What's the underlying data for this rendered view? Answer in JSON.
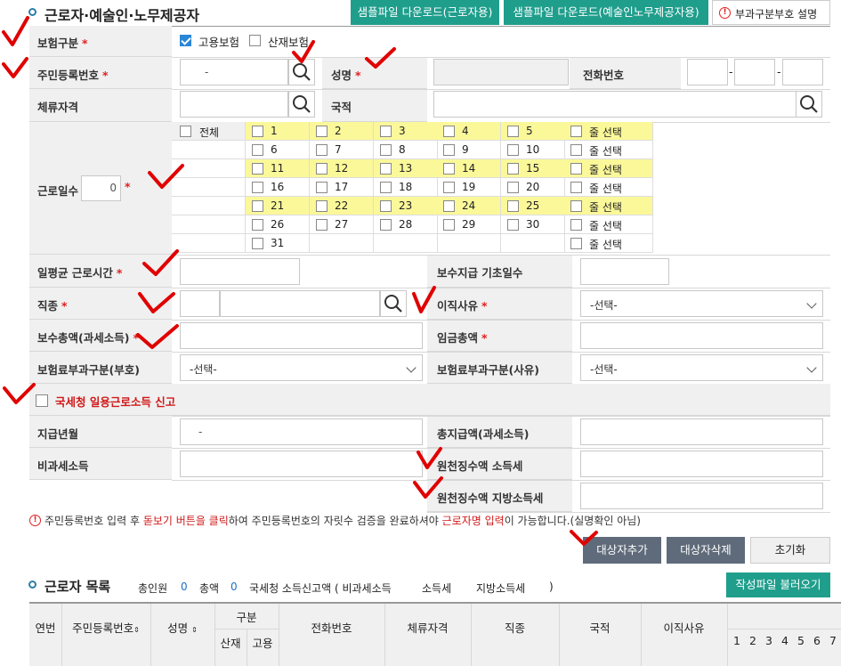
{
  "section_title": "근로자·예술인·노무제공자",
  "header_buttons": {
    "sample_worker": "샘플파일 다운로드(근로자용)",
    "sample_artist": "샘플파일 다운로드(예술인노무제공자용)",
    "code_help": "부과구분부호 설명"
  },
  "form": {
    "insurance_type_label": "보험구분",
    "employment_ins": "고용보험",
    "industrial_ins": "산재보험",
    "rrn_label": "주민등록번호",
    "rrn_dash": "-",
    "name_label": "성명",
    "phone_label": "전화번호",
    "phone_dash1": "-",
    "phone_dash2": "-",
    "stay_label": "체류자격",
    "nation_label": "국적",
    "workdays_label": "근로일수",
    "workdays_value": "0",
    "all_label": "전체",
    "row_select": "줄 선택",
    "days": [
      "1",
      "2",
      "3",
      "4",
      "5",
      "6",
      "7",
      "8",
      "9",
      "10",
      "11",
      "12",
      "13",
      "14",
      "15",
      "16",
      "17",
      "18",
      "19",
      "20",
      "21",
      "22",
      "23",
      "24",
      "25",
      "26",
      "27",
      "28",
      "29",
      "30",
      "31"
    ],
    "avg_hours_label": "일평균 근로시간",
    "pay_base_days_label": "보수지급 기초일수",
    "job_label": "직종",
    "leave_reason_label": "이직사유",
    "leave_reason_value": "-선택-",
    "total_pay_label": "보수총액(과세소득)",
    "wage_total_label": "임금총액",
    "ins_code_label": "보험료부과구분(부호)",
    "ins_code_value": "-선택-",
    "ins_reason_label": "보험료부과구분(사유)",
    "ins_reason_value": "-선택-",
    "nts_report_label": "국세청 일용근로소득 신고",
    "pay_month_label": "지급년월",
    "pay_month_dash": "-",
    "total_income_label": "총지급액(과세소득)",
    "nontax_label": "비과세소득",
    "withhold_income_label": "원천징수액 소득세",
    "withhold_local_label": "원천징수액 지방소득세"
  },
  "notice": {
    "p1": "주민등록번호 입력 후 ",
    "p2": "돋보기 버튼을 클릭",
    "p3": "하여 주민등록번호의 자릿수 검증을 완료하셔야 ",
    "p4": "근로자명 입력",
    "p5": "이 가능합니다.(실명확인 아님)"
  },
  "actions": {
    "add": "대상자추가",
    "delete": "대상자삭제",
    "reset": "초기화"
  },
  "list": {
    "title": "근로자 목록",
    "total_count_label": "총인원",
    "total_count": "0",
    "total_amount_label": "총액",
    "total_amount": "0",
    "nts_label": "국세청 소득신고액 ( 비과세소득",
    "income_tax": "소득세",
    "local_tax": "지방소득세",
    "close_paren": ")",
    "load_button": "작성파일 불러오기",
    "cols": {
      "no": "연번",
      "rrn": "주민등록번호",
      "name": "성명",
      "category": "구분",
      "sanjae": "산재",
      "goyong": "고용",
      "phone": "전화번호",
      "stay": "체류자격",
      "job": "직종",
      "nation": "국적",
      "leave": "이직사유"
    },
    "day_cols": [
      "1",
      "2",
      "3",
      "4",
      "5",
      "6",
      "7"
    ]
  },
  "colors": {
    "teal": "#1f9e8c",
    "required": "#e02020",
    "yellow_row": "#fbf89a",
    "annotation_red": "#e00000"
  }
}
